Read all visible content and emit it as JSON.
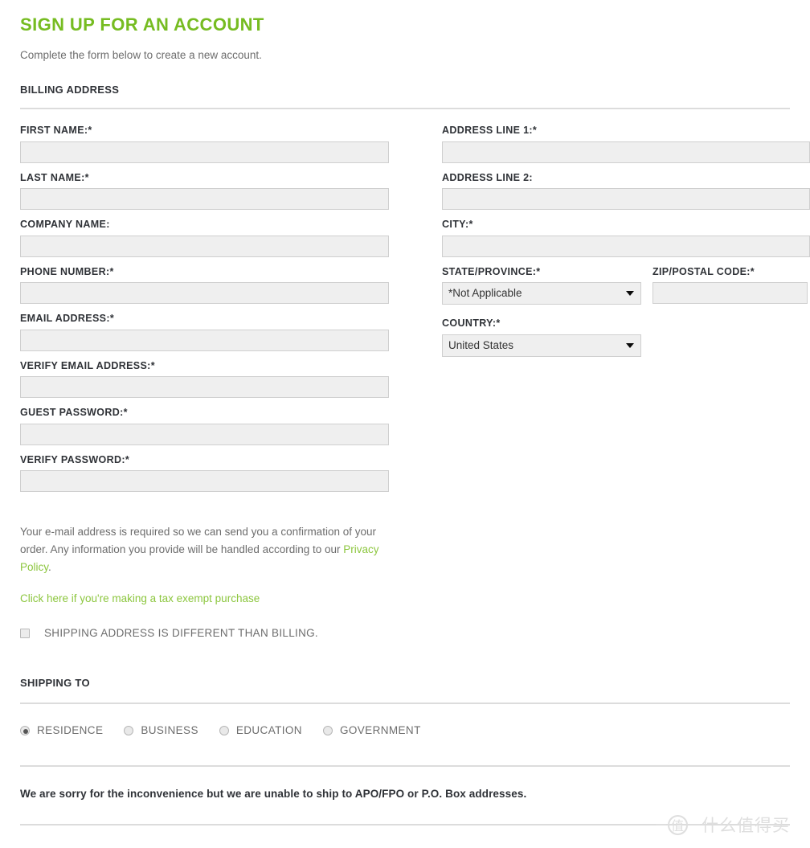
{
  "header": {
    "title": "SIGN UP FOR AN ACCOUNT",
    "subtitle": "Complete the form below to create a new account.",
    "section_title": "BILLING ADDRESS"
  },
  "billing": {
    "left_fields": [
      {
        "label": "FIRST NAME:*",
        "value": "",
        "placeholder": "",
        "name": "first-name"
      },
      {
        "label": "LAST NAME:*",
        "value": "",
        "placeholder": "",
        "name": "last-name"
      },
      {
        "label": "COMPANY NAME:",
        "value": "",
        "placeholder": "",
        "name": "company-name"
      },
      {
        "label": "PHONE NUMBER:*",
        "value": "",
        "placeholder": "",
        "name": "phone-number"
      },
      {
        "label": "EMAIL ADDRESS:*",
        "value": "",
        "placeholder": "",
        "name": "email-address"
      },
      {
        "label": "VERIFY EMAIL ADDRESS:*",
        "value": "",
        "placeholder": "",
        "name": "verify-email-address"
      },
      {
        "label": "GUEST PASSWORD:*",
        "value": "",
        "placeholder": "",
        "name": "guest-password"
      },
      {
        "label": "VERIFY PASSWORD:*",
        "value": "",
        "placeholder": "",
        "name": "verify-password"
      }
    ],
    "address_line_1": {
      "label": "ADDRESS LINE 1:*",
      "value": "",
      "placeholder": ""
    },
    "address_line_2": {
      "label": "ADDRESS LINE 2:",
      "value": "",
      "placeholder": ""
    },
    "city": {
      "label": "CITY:*",
      "value": "",
      "placeholder": ""
    },
    "state": {
      "label": "STATE/PROVINCE:*",
      "selected": "*Not Applicable",
      "options": [
        "*Not Applicable"
      ]
    },
    "zip": {
      "label": "ZIP/POSTAL CODE:*",
      "value": "",
      "placeholder": ""
    },
    "country": {
      "label": "COUNTRY:*",
      "selected": "United States",
      "options": [
        "United States"
      ]
    }
  },
  "notes": {
    "email_note_part1": "Your e-mail address is required so we can send you a confirmation of your order. Any information you provide will be handled according to our ",
    "privacy_policy_link": "Privacy Policy",
    "email_note_part3": ".",
    "tax_exempt_link": "Click here if you're making a tax exempt purchase"
  },
  "shipping_different": {
    "label": "SHIPPING ADDRESS IS DIFFERENT THAN BILLING.",
    "checked": false
  },
  "shipping": {
    "section_title": "SHIPPING TO",
    "options": [
      {
        "label": "RESIDENCE",
        "checked": true
      },
      {
        "label": "BUSINESS",
        "checked": false
      },
      {
        "label": "EDUCATION",
        "checked": false
      },
      {
        "label": "GOVERNMENT",
        "checked": false
      }
    ]
  },
  "footer": {
    "notice": "We are sorry for the inconvenience but we are unable to ship to APO/FPO or P.O. Box addresses."
  },
  "watermark": {
    "mark": "值",
    "text": "什么值得买"
  },
  "colors": {
    "accent_green": "#76bc21",
    "link_green": "#8cc63e",
    "label_dark": "#2f3237",
    "body_gray": "#6d6d6d",
    "input_bg": "#efefef",
    "input_border": "#cfcfcf",
    "rule": "#dcdcdc"
  },
  "icons": {
    "select_arrow": "chevron-down-icon",
    "checkbox": "checkbox-icon",
    "radio": "radio-icon"
  }
}
